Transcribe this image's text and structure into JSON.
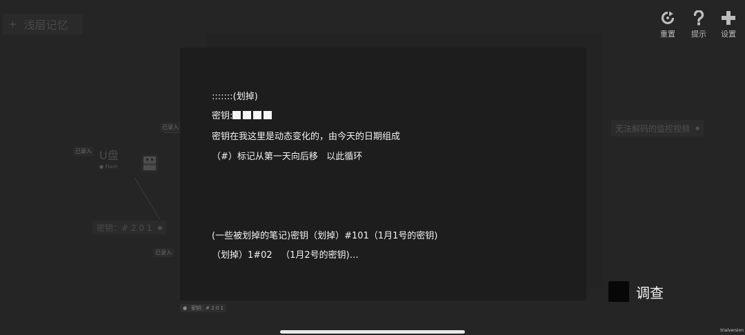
{
  "top_left": {
    "plus": "+",
    "title": "浅层记忆"
  },
  "toolbar": {
    "reset_label": "重置",
    "hint_label": "提示",
    "settings_label": "设置",
    "reset_icon": "refresh-icon",
    "hint_icon": "question-icon",
    "settings_icon": "plus-icon"
  },
  "background_nodes": {
    "recorded_tag": "已录入",
    "usb_title": "U盘",
    "usb_sub": "● Flash",
    "password_label": "密钥：",
    "password_code": "# 2 0 1",
    "dot": "●",
    "undecodable_video": "无法解码的监控视频"
  },
  "modal": {
    "line1": ":::::::(划掉)",
    "line2_prefix": "密钥:",
    "line3": "密钥在我这里是动态变化的，由今天的日期组成",
    "line4": "（#）标记从第一天向后移   以此循环",
    "line5": "(一些被划掉的笔记)密钥（划掉）#101（1月1号的密钥)",
    "line6": "（划掉）1#02   （1月2号的密钥)…"
  },
  "bottom_tag": {
    "dot": "●",
    "text": "密钥：# 2 0 1"
  },
  "investigate": {
    "label": "调查"
  },
  "watermark": "trialversion"
}
